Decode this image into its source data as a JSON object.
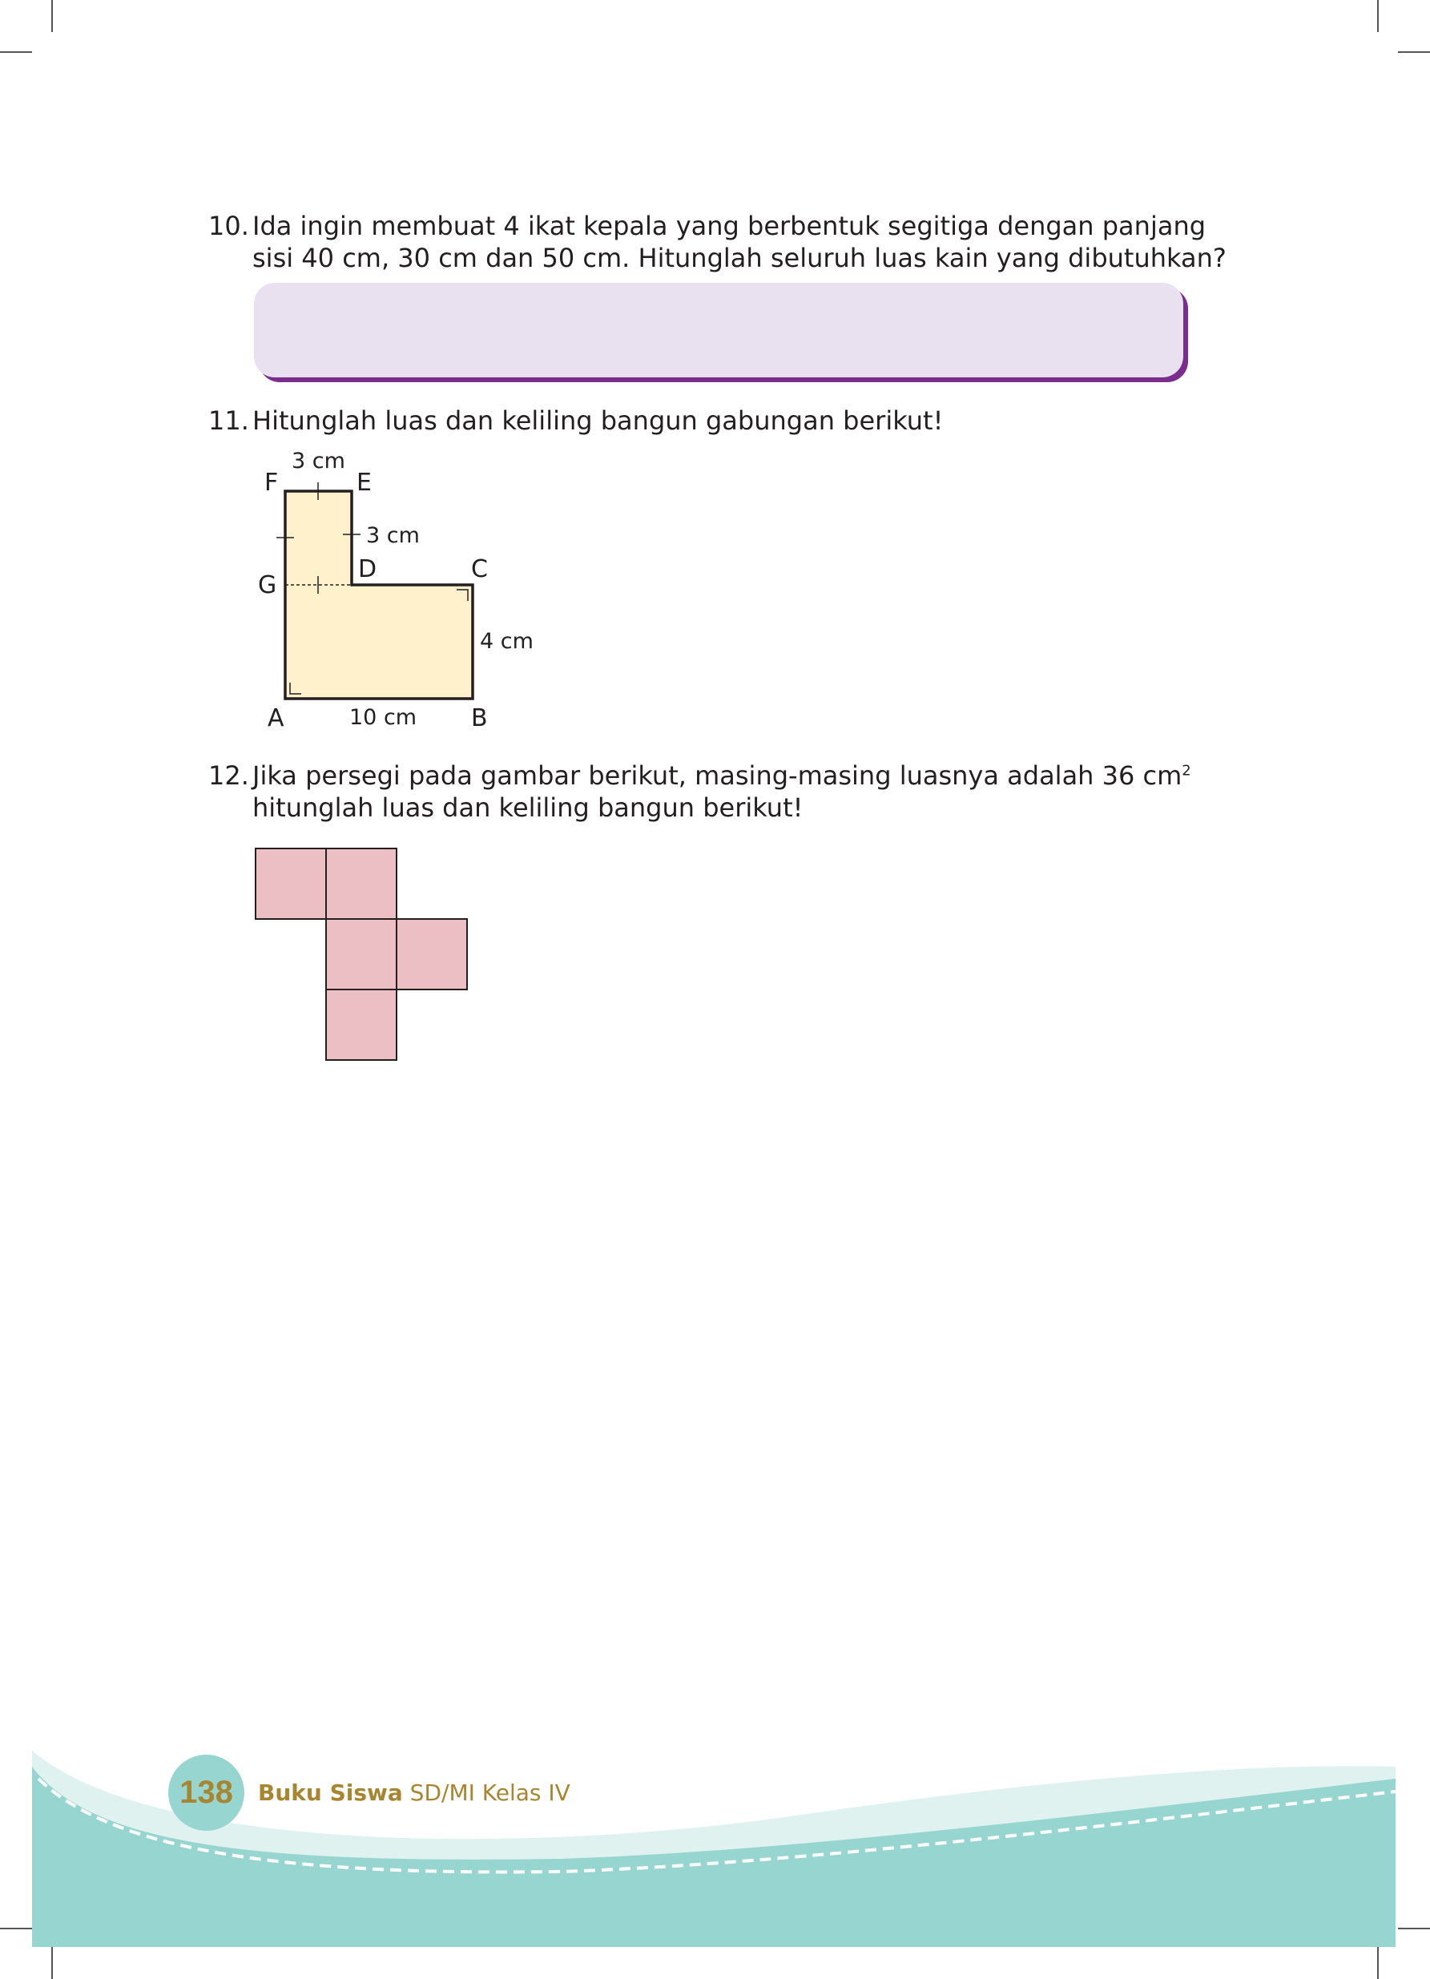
{
  "questions": {
    "q10": {
      "number": "10.",
      "line1": "Ida ingin membuat 4 ikat kepala yang berbentuk segitiga dengan panjang",
      "line2": "sisi 40 cm, 30 cm dan 50 cm. Hitunglah seluruh luas kain yang dibutuhkan?"
    },
    "q11": {
      "number": "11.",
      "line1": "Hitunglah luas dan keliling bangun gabungan berikut!"
    },
    "q12": {
      "number": "12.",
      "line1_main": "Jika persegi pada gambar berikut, masing-masing luasnya adalah 36 cm",
      "line1_sup": "2",
      "line2": "hitunglah luas dan keliling bangun berikut!"
    }
  },
  "figure11": {
    "points": {
      "A": "A",
      "B": "B",
      "C": "C",
      "D": "D",
      "E": "E",
      "F": "F",
      "G": "G"
    },
    "labels": {
      "top": "3 cm",
      "ed": "3 cm",
      "bc": "4 cm",
      "ab": "10 cm"
    },
    "fill_color": "#fff1cc"
  },
  "figure12": {
    "square_color": "#ebbfc3",
    "square_count": 5
  },
  "footer": {
    "page_number": "138",
    "book_bold": "Buku Siswa",
    "book_rest": " SD/MI Kelas IV",
    "band_color": "#97d5d1",
    "accent_color": "#a8852f"
  }
}
